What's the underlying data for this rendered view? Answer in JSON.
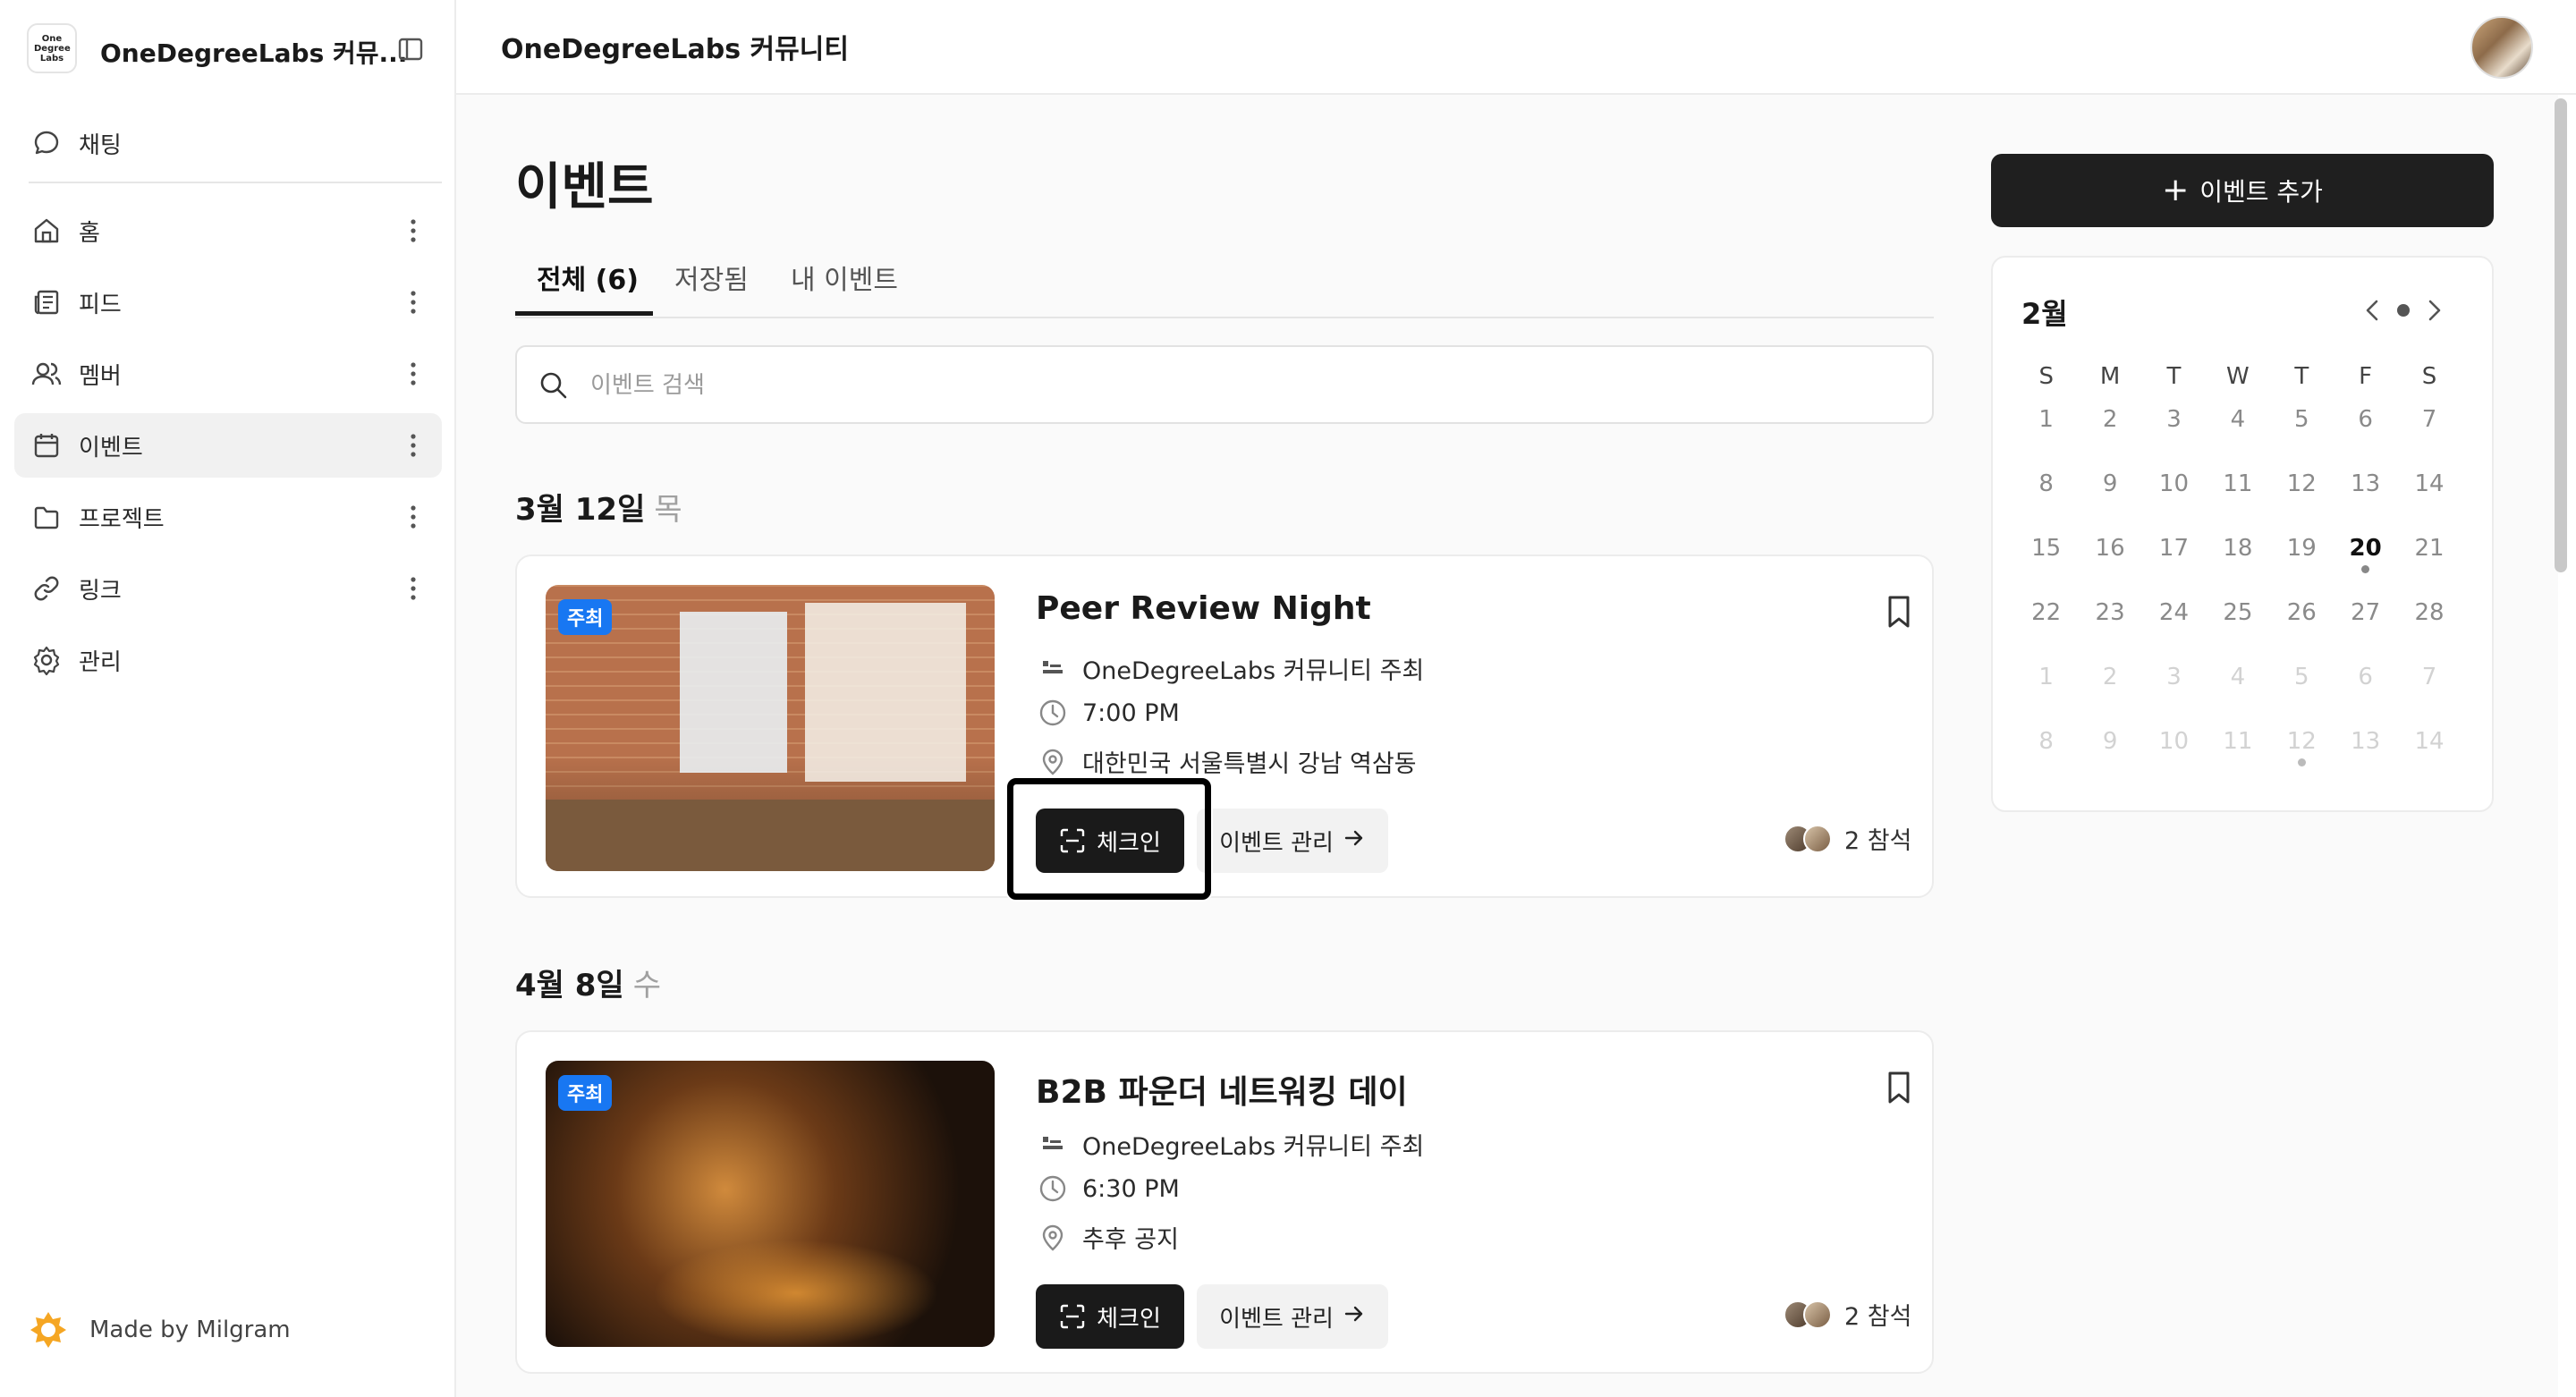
{
  "sidebar": {
    "workspace_logo_text": "One Degree Labs",
    "workspace_name": "OneDegreeLabs 커뮤...",
    "chat_label": "채팅",
    "items": [
      {
        "label": "홈",
        "icon": "home-icon"
      },
      {
        "label": "피드",
        "icon": "feed-icon"
      },
      {
        "label": "멤버",
        "icon": "members-icon"
      },
      {
        "label": "이벤트",
        "icon": "calendar-icon",
        "active": true
      },
      {
        "label": "프로젝트",
        "icon": "folder-icon"
      },
      {
        "label": "링크",
        "icon": "link-icon"
      },
      {
        "label": "관리",
        "icon": "gear-icon"
      }
    ],
    "made_by": "Made by Milgram"
  },
  "header": {
    "title": "OneDegreeLabs 커뮤니티"
  },
  "main": {
    "page_title": "이벤트",
    "tabs": [
      {
        "label": "전체 (6)",
        "active": true
      },
      {
        "label": "저장됨"
      },
      {
        "label": "내 이벤트"
      }
    ],
    "search_placeholder": "이벤트 검색",
    "groups": [
      {
        "date": "3월 12일",
        "weekday": "목",
        "event": {
          "badge": "주최",
          "title": "Peer Review Night",
          "host": "OneDegreeLabs 커뮤니티 주최",
          "time": "7:00 PM",
          "location": "대한민국 서울특별시 강남 역삼동",
          "checkin_label": "체크인",
          "manage_label": "이벤트 관리",
          "attendees": "2 참석"
        }
      },
      {
        "date": "4월 8일",
        "weekday": "수",
        "event": {
          "badge": "주최",
          "title": "B2B 파운더 네트워킹 데이",
          "host": "OneDegreeLabs 커뮤니티 주최",
          "time": "6:30 PM",
          "location": "추후 공지",
          "checkin_label": "체크인",
          "manage_label": "이벤트 관리",
          "attendees": "2 참석"
        }
      }
    ]
  },
  "right": {
    "add_event_label": "이벤트 추가",
    "calendar": {
      "month": "2월",
      "weekdays": [
        "S",
        "M",
        "T",
        "W",
        "T",
        "F",
        "S"
      ],
      "weeks": [
        [
          "1",
          "2",
          "3",
          "4",
          "5",
          "6",
          "7"
        ],
        [
          "8",
          "9",
          "10",
          "11",
          "12",
          "13",
          "14"
        ],
        [
          "15",
          "16",
          "17",
          "18",
          "19",
          "20",
          "21"
        ],
        [
          "22",
          "23",
          "24",
          "25",
          "26",
          "27",
          "28"
        ],
        [
          "1",
          "2",
          "3",
          "4",
          "5",
          "6",
          "7"
        ],
        [
          "8",
          "9",
          "10",
          "11",
          "12",
          "13",
          "14"
        ]
      ],
      "today": "20",
      "event_day_current": "20",
      "event_day_next_month": "12"
    }
  },
  "colors": {
    "accent_dark": "#1a1a1a",
    "badge_blue": "#1877f2",
    "muted_text": "#8a8a8a"
  }
}
